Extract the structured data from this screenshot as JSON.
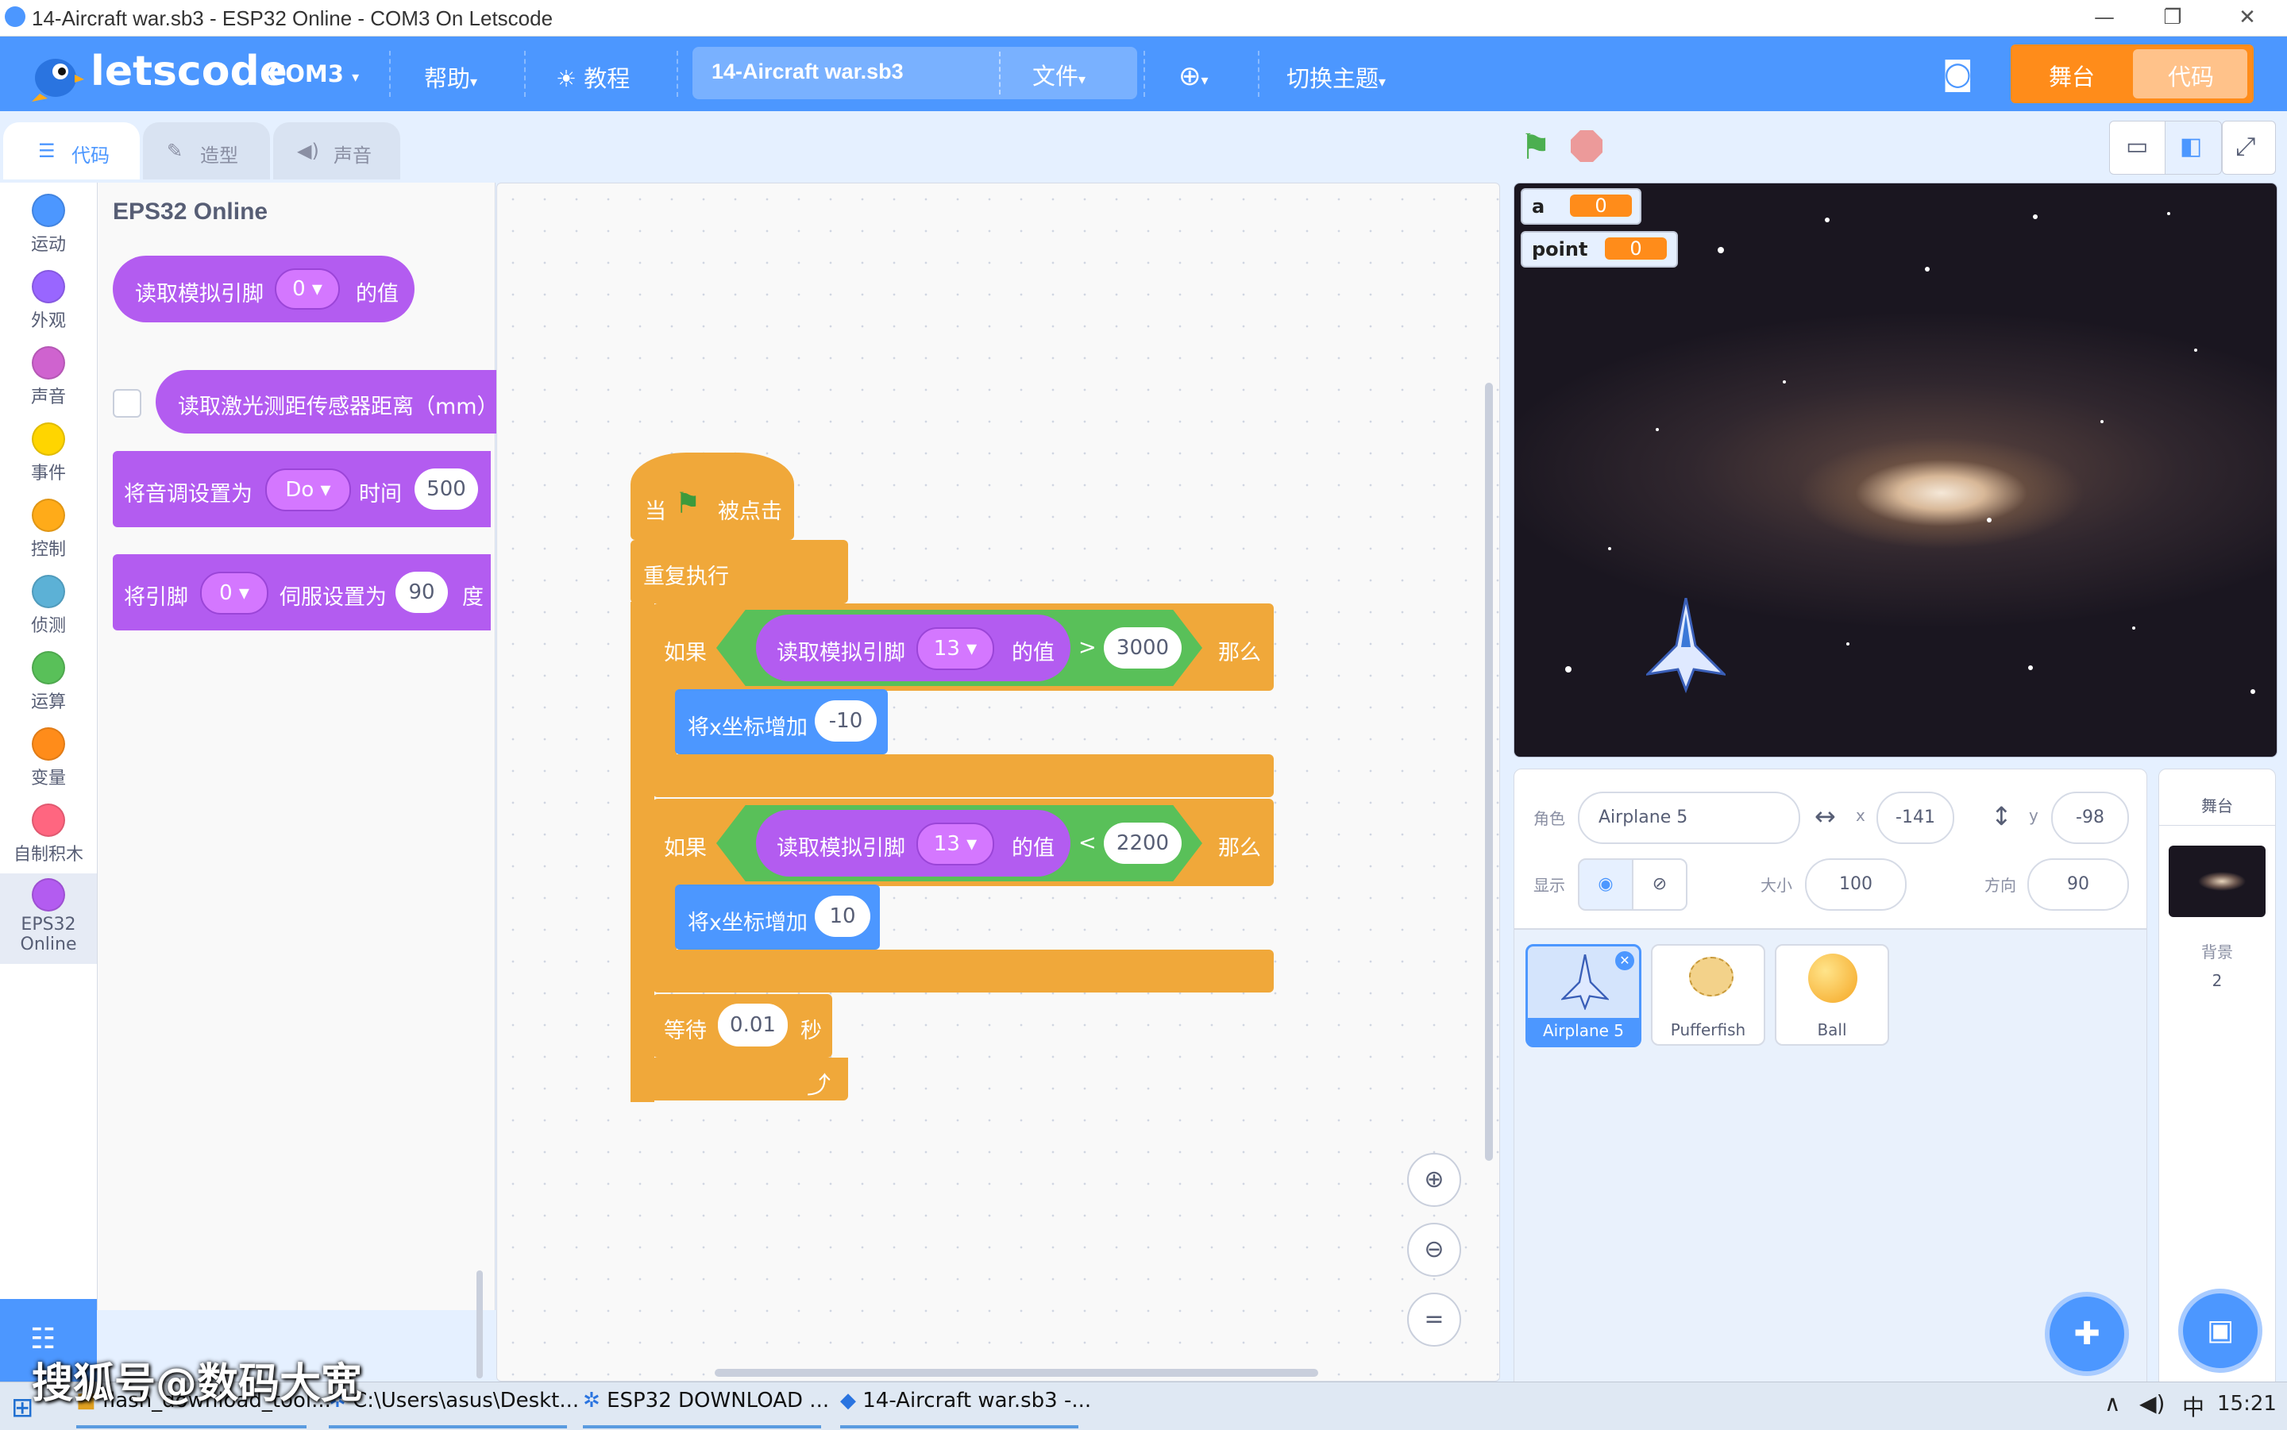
{
  "window": {
    "title": "14-Aircraft war.sb3 - ESP32 Online - COM3 On Letscode",
    "min": "—",
    "max": "❐",
    "close": "✕"
  },
  "menubar": {
    "logo": "letscode",
    "port": "COM3",
    "help": "帮助",
    "tutorial": "教程",
    "project_name": "14-Aircraft war.sb3",
    "file": "文件",
    "theme": "切换主题",
    "stage_button": "舞台",
    "code_button": "代码"
  },
  "tabs": {
    "code": "代码",
    "costume": "造型",
    "sound": "声音"
  },
  "categories": [
    {
      "label": "运动",
      "color": "#4c97ff"
    },
    {
      "label": "外观",
      "color": "#9966ff"
    },
    {
      "label": "声音",
      "color": "#cf63cf"
    },
    {
      "label": "事件",
      "color": "#ffd500"
    },
    {
      "label": "控制",
      "color": "#ffab19"
    },
    {
      "label": "侦测",
      "color": "#5cb1d6"
    },
    {
      "label": "运算",
      "color": "#59c059"
    },
    {
      "label": "变量",
      "color": "#ff8c1a"
    },
    {
      "label": "自制积木",
      "color": "#ff6680"
    },
    {
      "label": "EPS32 Online",
      "color": "#b35cf0"
    }
  ],
  "palette": {
    "title": "EPS32 Online",
    "read_analog": {
      "pre": "读取模拟引脚",
      "pin": "0",
      "post": "的值"
    },
    "laser": "读取激光测距传感器距离（mm）",
    "tone": {
      "pre": "将音调设置为",
      "note": "Do",
      "mid": "时间",
      "time": "500"
    },
    "servo": {
      "pre": "将引脚",
      "pin": "0",
      "mid": "伺服设置为",
      "angle": "90",
      "post": "度"
    }
  },
  "script": {
    "hat": {
      "pre": "当",
      "post": "被点击"
    },
    "forever": "重复执行",
    "if1": {
      "if": "如果",
      "read": "读取模拟引脚",
      "pin": "13",
      "val": "的值",
      "op": ">",
      "num": "3000",
      "then": "那么"
    },
    "change1": {
      "label": "将x坐标增加",
      "value": "-10"
    },
    "if2": {
      "if": "如果",
      "read": "读取模拟引脚",
      "pin": "13",
      "val": "的值",
      "op": "<",
      "num": "2200",
      "then": "那么"
    },
    "change2": {
      "label": "将x坐标增加",
      "value": "10"
    },
    "wait": {
      "pre": "等待",
      "value": "0.01",
      "post": "秒"
    }
  },
  "monitors": [
    {
      "name": "a",
      "value": "0"
    },
    {
      "name": "point",
      "value": "0"
    }
  ],
  "sprite_info": {
    "sprite_label": "角色",
    "sprite_name": "Airplane 5",
    "x_label": "x",
    "x": "-141",
    "y_label": "y",
    "y": "-98",
    "show_label": "显示",
    "size_label": "大小",
    "size": "100",
    "direction_label": "方向",
    "direction": "90"
  },
  "sprites": [
    {
      "name": "Airplane 5",
      "selected": true
    },
    {
      "name": "Pufferfish",
      "selected": false
    },
    {
      "name": "Ball",
      "selected": false
    }
  ],
  "stage_panel": {
    "title": "舞台",
    "backdrop_label": "背景",
    "backdrop_count": "2"
  },
  "taskbar": {
    "items": [
      "flash_download_tool...",
      "C:\\Users\\asus\\Deskt...",
      "ESP32 DOWNLOAD ...",
      "14-Aircraft war.sb3 -..."
    ],
    "ime": "中",
    "time": "15:21"
  },
  "watermark": "搜狐号@数码大宽"
}
